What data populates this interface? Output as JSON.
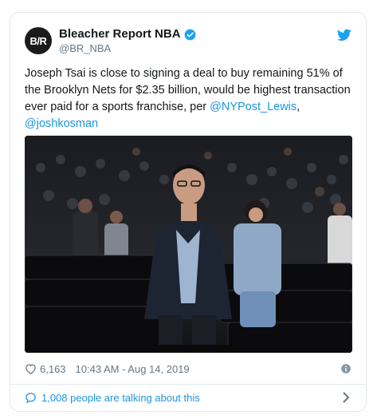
{
  "account": {
    "avatar_text": "B/R",
    "display_name": "Bleacher Report NBA",
    "handle": "@BR_NBA"
  },
  "tweet": {
    "text_part1": "Joseph Tsai is close to signing a deal to buy remaining 51% of the Brooklyn Nets for $2.35 billion, would be highest transaction ever paid for a sports franchise, per ",
    "mention1": "@NYPost_Lewis",
    "text_part2": ", ",
    "mention2": "@joshkosman"
  },
  "meta": {
    "likes": "6,163",
    "timestamp": "10:43 AM - Aug 14, 2019"
  },
  "footer": {
    "talking_text": "1,008 people are talking about this"
  },
  "colors": {
    "link": "#1b95e0",
    "secondary_text": "#657786",
    "border": "#e1e8ed"
  },
  "icons": [
    "verified-badge-icon",
    "twitter-bird-icon",
    "heart-icon",
    "info-icon",
    "speech-bubble-icon",
    "chevron-right-icon"
  ]
}
